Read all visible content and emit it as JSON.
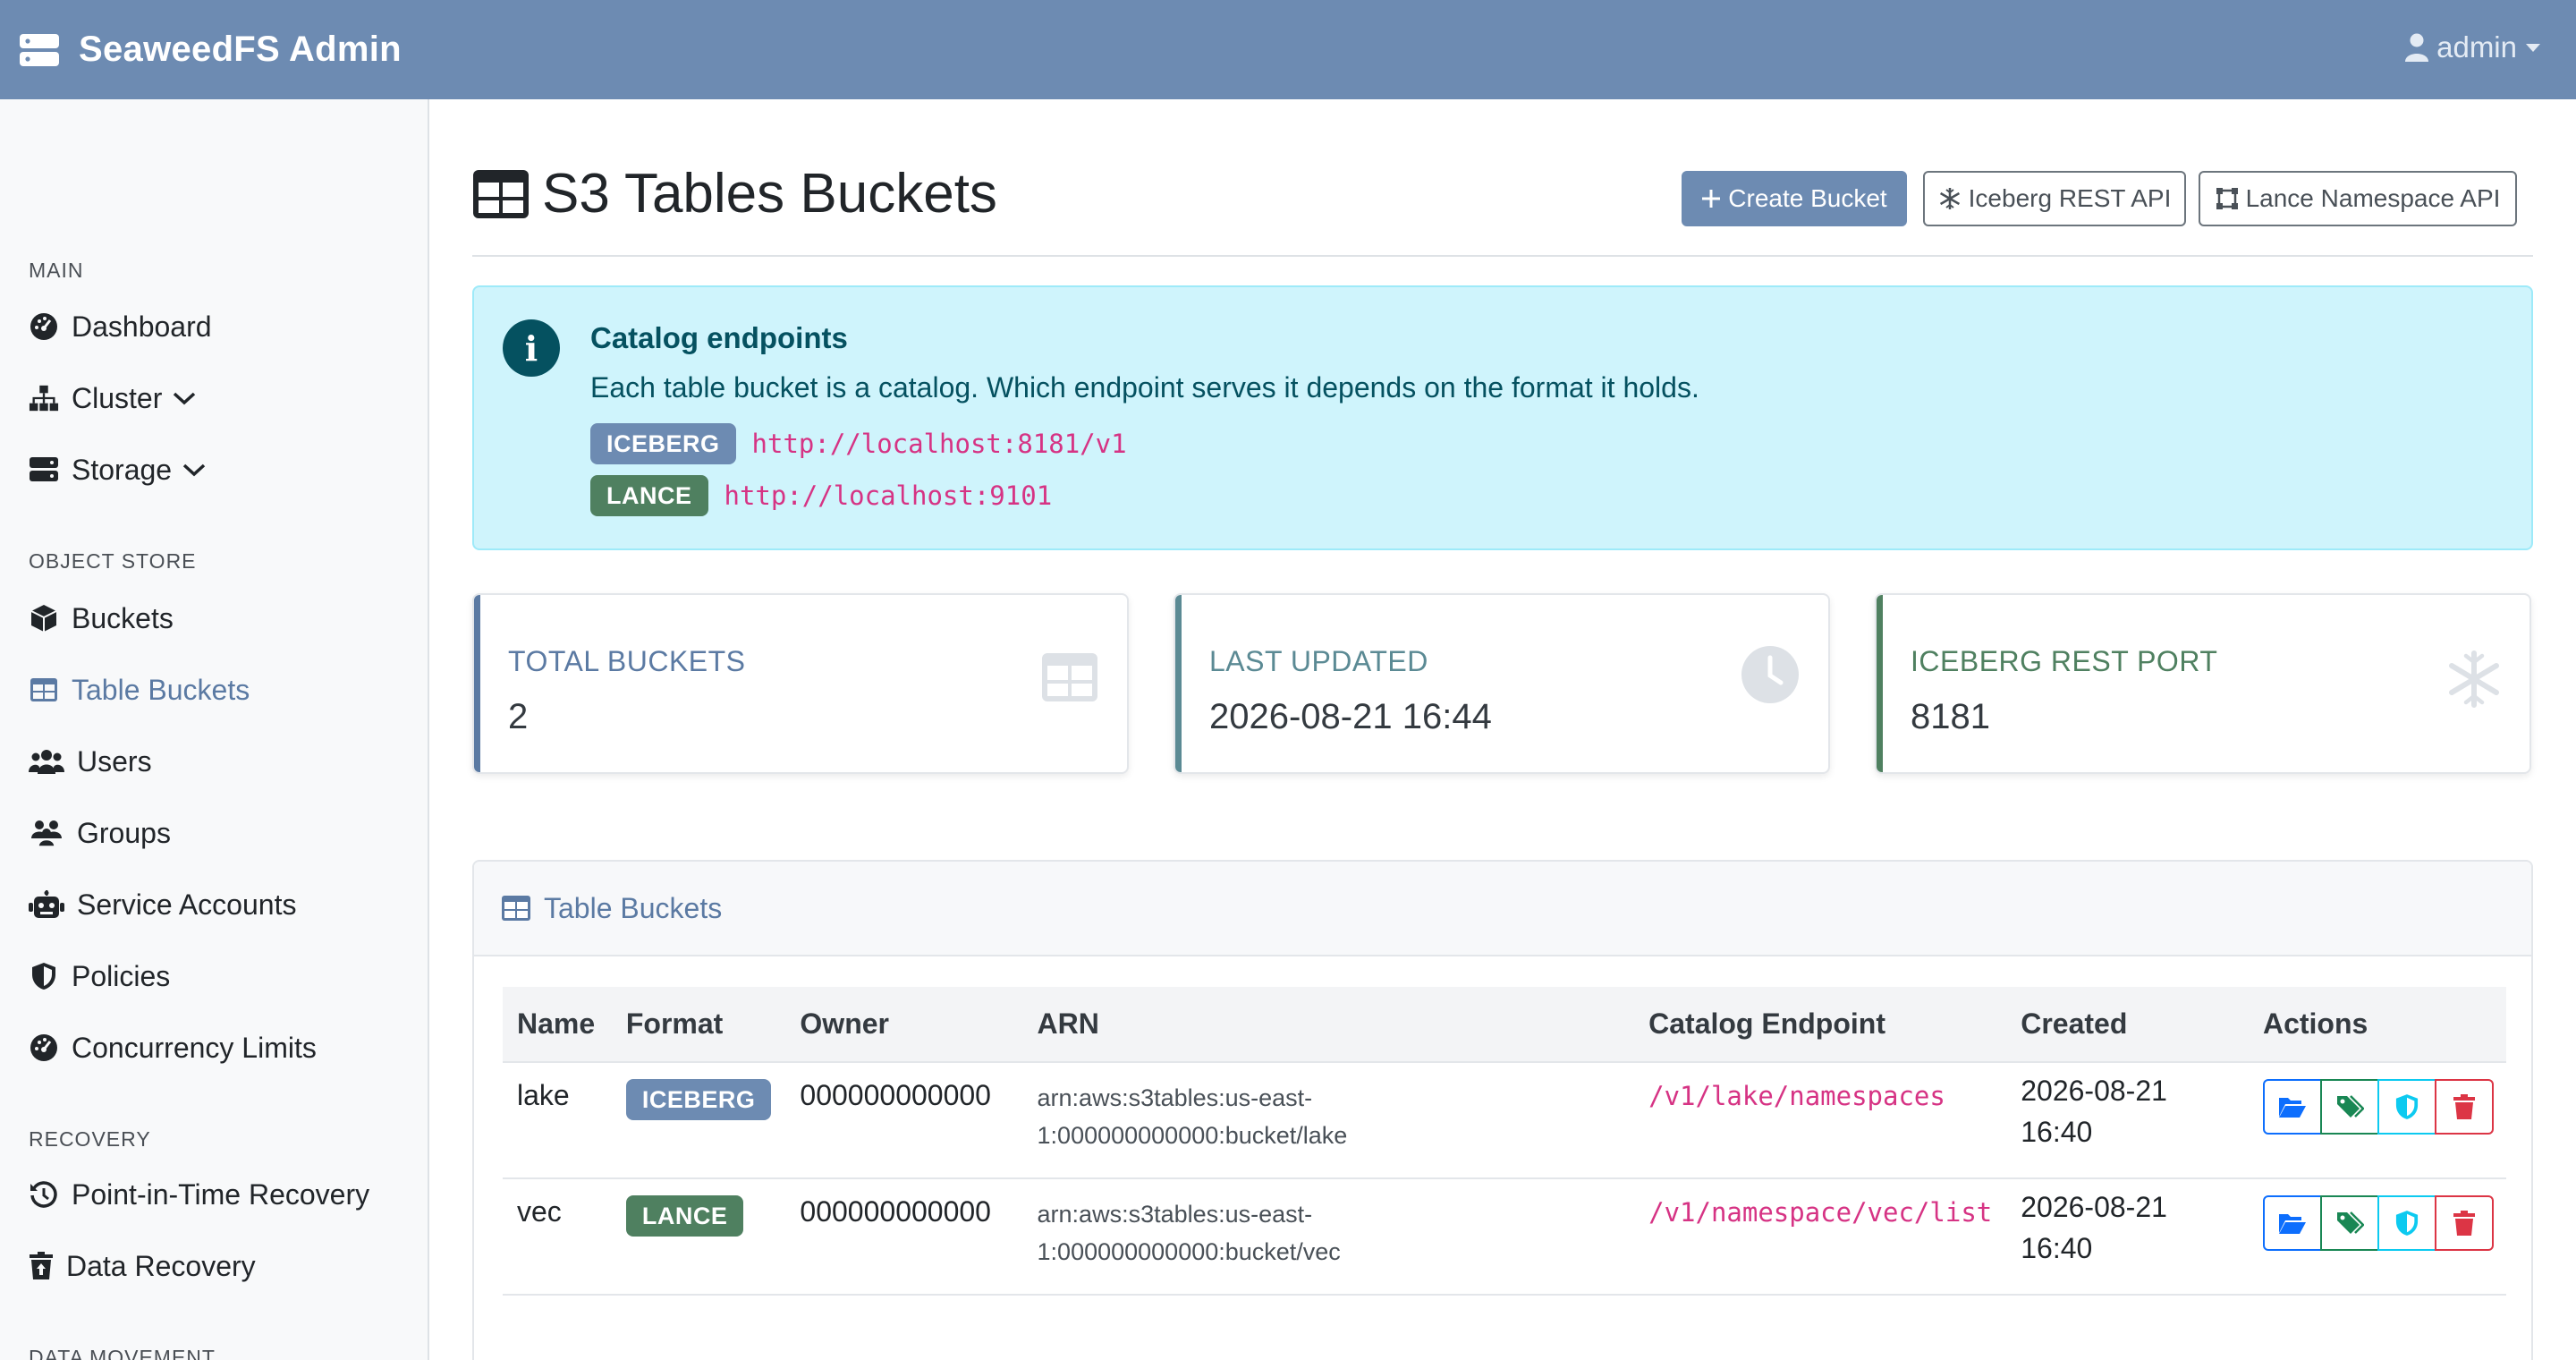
{
  "app": {
    "brand": "SeaweedFS Admin",
    "user": "admin"
  },
  "sidebar": {
    "sections": [
      {
        "heading": "MAIN"
      },
      {
        "heading": "OBJECT STORE"
      },
      {
        "heading": "RECOVERY"
      },
      {
        "heading": "DATA MOVEMENT"
      }
    ],
    "items": [
      {
        "label": "Dashboard",
        "icon": "gauge-icon"
      },
      {
        "label": "Cluster",
        "icon": "sitemap-icon"
      },
      {
        "label": "Storage",
        "icon": "server-icon"
      },
      {
        "label": "Buckets",
        "icon": "cube-icon"
      },
      {
        "label": "Table Buckets",
        "icon": "table-icon",
        "active": true
      },
      {
        "label": "Users",
        "icon": "users-icon"
      },
      {
        "label": "Groups",
        "icon": "user-group-icon"
      },
      {
        "label": "Service Accounts",
        "icon": "robot-icon"
      },
      {
        "label": "Policies",
        "icon": "shield-icon"
      },
      {
        "label": "Concurrency Limits",
        "icon": "gauge-icon"
      },
      {
        "label": "Point-in-Time Recovery",
        "icon": "history-icon"
      },
      {
        "label": "Data Recovery",
        "icon": "trash-restore-icon"
      }
    ]
  },
  "page": {
    "title": "S3 Tables Buckets",
    "buttons": {
      "create": "Create Bucket",
      "iceberg": "Iceberg REST API",
      "lance": "Lance Namespace API"
    }
  },
  "alert": {
    "title": "Catalog endpoints",
    "text": "Each table bucket is a catalog. Which endpoint serves it depends on the format it holds.",
    "endpoints": [
      {
        "badge": "ICEBERG",
        "url": "http://localhost:8181/v1"
      },
      {
        "badge": "LANCE",
        "url": "http://localhost:9101"
      }
    ]
  },
  "stats": [
    {
      "label": "TOTAL BUCKETS",
      "value": "2",
      "color": "#5b7aa3"
    },
    {
      "label": "LAST UPDATED",
      "value": "2026-08-21 16:44",
      "color": "#5b8a94"
    },
    {
      "label": "ICEBERG REST PORT",
      "value": "8181",
      "color": "#4f8060"
    }
  ],
  "table": {
    "title": "Table Buckets",
    "columns": [
      "Name",
      "Format",
      "Owner",
      "ARN",
      "Catalog Endpoint",
      "Created",
      "Actions"
    ],
    "rows": [
      {
        "name": "lake",
        "format": "ICEBERG",
        "owner": "000000000000",
        "arn1": "arn:aws:s3tables:us-east-",
        "arn2": "1:000000000000:bucket/lake",
        "endpoint": "/v1/lake/namespaces",
        "created1": "2026-08-21",
        "created2": "16:40"
      },
      {
        "name": "vec",
        "format": "LANCE",
        "owner": "000000000000",
        "arn1": "arn:aws:s3tables:us-east-",
        "arn2": "1:000000000000:bucket/vec",
        "endpoint": "/v1/namespace/vec/list",
        "created1": "2026-08-21",
        "created2": "16:40"
      }
    ]
  },
  "colors": {
    "navbar": "#6d8bb2",
    "accent": "#5b7aa3",
    "iceberg_badge": "#6d8bb2",
    "lance_badge": "#4f8060",
    "endpoint_text": "#d63384",
    "alert_bg": "#cff4fc"
  }
}
